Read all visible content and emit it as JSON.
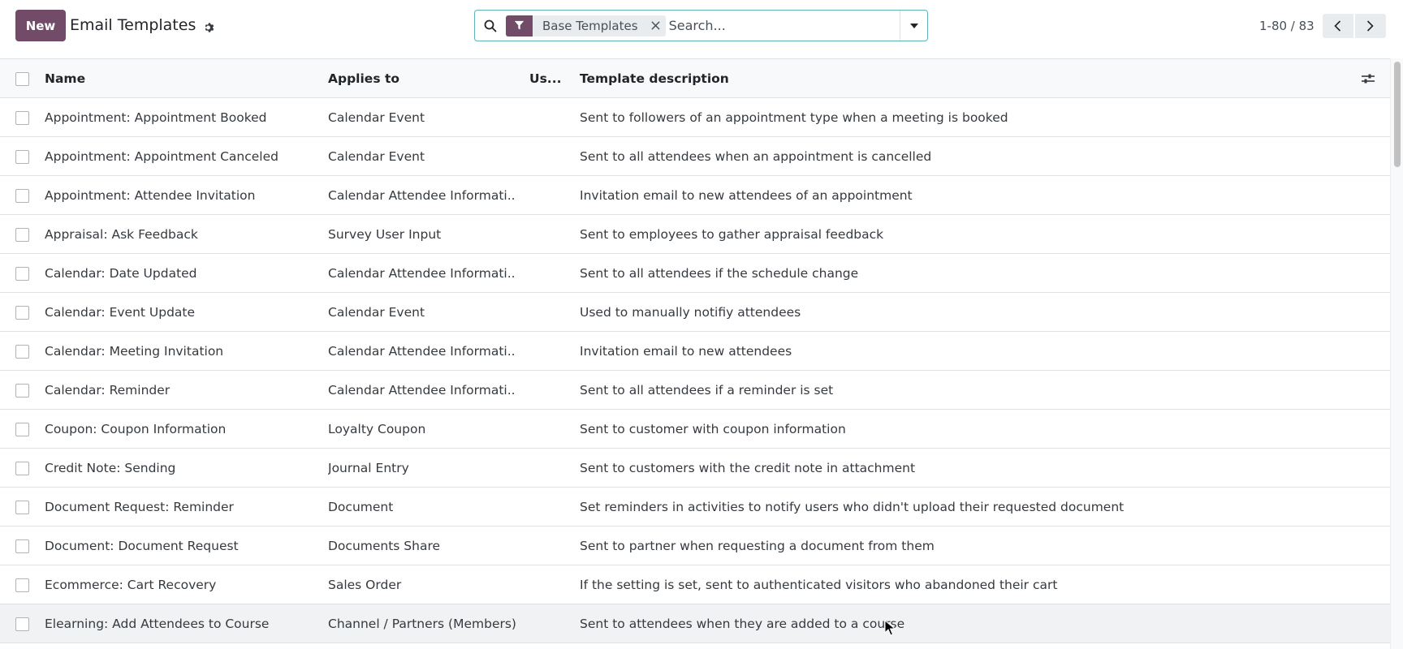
{
  "control_panel": {
    "new_label": "New",
    "title": "Email Templates",
    "search": {
      "facet_label": "Base Templates",
      "placeholder": "Search..."
    },
    "pager": {
      "value": "1-80 / 83"
    }
  },
  "list": {
    "columns": {
      "name": "Name",
      "model": "Applies to",
      "used": "Us...",
      "description": "Template description"
    },
    "rows": [
      {
        "name": "Appointment: Appointment Booked",
        "model": "Calendar Event",
        "description": "Sent to followers of an appointment type when a meeting is booked"
      },
      {
        "name": "Appointment: Appointment Canceled",
        "model": "Calendar Event",
        "description": "Sent to all attendees when an appointment is cancelled"
      },
      {
        "name": "Appointment: Attendee Invitation",
        "model": "Calendar Attendee Informati...",
        "description": "Invitation email to new attendees of an appointment"
      },
      {
        "name": "Appraisal: Ask Feedback",
        "model": "Survey User Input",
        "description": "Sent to employees to gather appraisal feedback"
      },
      {
        "name": "Calendar: Date Updated",
        "model": "Calendar Attendee Informati...",
        "description": "Sent to all attendees if the schedule change"
      },
      {
        "name": "Calendar: Event Update",
        "model": "Calendar Event",
        "description": "Used to manually notifiy attendees"
      },
      {
        "name": "Calendar: Meeting Invitation",
        "model": "Calendar Attendee Informati...",
        "description": "Invitation email to new attendees"
      },
      {
        "name": "Calendar: Reminder",
        "model": "Calendar Attendee Informati...",
        "description": "Sent to all attendees if a reminder is set"
      },
      {
        "name": "Coupon: Coupon Information",
        "model": "Loyalty Coupon",
        "description": "Sent to customer with coupon information"
      },
      {
        "name": "Credit Note: Sending",
        "model": "Journal Entry",
        "description": "Sent to customers with the credit note in attachment"
      },
      {
        "name": "Document Request: Reminder",
        "model": "Document",
        "description": "Set reminders in activities to notify users who didn't upload their requested document"
      },
      {
        "name": "Document: Document Request",
        "model": "Documents Share",
        "description": "Sent to partner when requesting a document from them"
      },
      {
        "name": "Ecommerce: Cart Recovery",
        "model": "Sales Order",
        "description": "If the setting is set, sent to authenticated visitors who abandoned their cart"
      },
      {
        "name": "Elearning: Add Attendees to Course",
        "model": "Channel / Partners (Members)",
        "description": "Sent to attendees when they are added to a course"
      }
    ]
  },
  "colors": {
    "brand": "#714B67",
    "search_border": "#5bb5b7",
    "row_border": "#dee2e6"
  },
  "icons": {
    "gear": "gear-icon",
    "search": "search-icon",
    "filter": "filter-icon",
    "remove": "close-icon",
    "dropdown": "caret-down-icon",
    "prev": "chevron-left-icon",
    "next": "chevron-right-icon",
    "optional_columns": "sliders-icon"
  }
}
